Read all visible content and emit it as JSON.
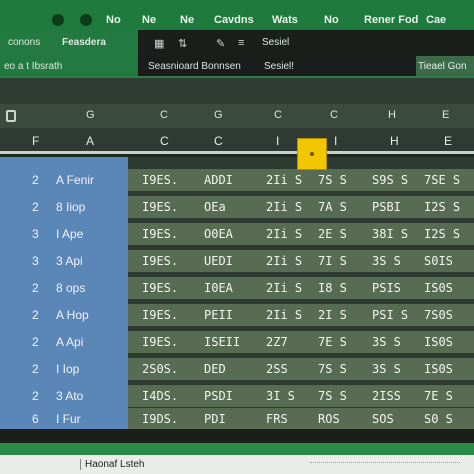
{
  "ribbon": {
    "tabs": [
      "No",
      "Ne",
      "Ne",
      "Cavdns",
      "Wats",
      "No",
      "Rener Fod",
      "Cae"
    ],
    "row2": {
      "left1": "conons",
      "left2": "Feasdera",
      "middle": "Sesiel",
      "middle2": "Seasnioard Bonnsen",
      "right": "Tieael Gon"
    },
    "namebar": {
      "left": "eo a t Ibsrath",
      "formula": "Sesiel!"
    }
  },
  "columns": [
    "G",
    "C",
    "G",
    "C",
    "C",
    "H",
    "E"
  ],
  "headers": [
    "F",
    "A",
    "C",
    "C",
    "I",
    "I",
    "H",
    "E"
  ],
  "rows": [
    {
      "num": "2",
      "label": "A Fenir",
      "cells": [
        "I9ES.",
        "ADDI",
        "2Ii S",
        "7S S",
        "S9S S",
        "7SE S"
      ]
    },
    {
      "num": "2",
      "label": "8 Iiop",
      "cells": [
        "I9ES.",
        "OEa",
        "2Ii S",
        "7A S",
        "PSBI",
        "I2S S"
      ]
    },
    {
      "num": "3",
      "label": "I Ape",
      "cells": [
        "I9ES.",
        "O0EA",
        "2Ii S",
        "2E S",
        "38I S",
        "I2S S"
      ]
    },
    {
      "num": "3",
      "label": "3 Api",
      "cells": [
        "I9ES.",
        "UEDI",
        "2Ii S",
        "7I S",
        "3S S",
        "S0IS"
      ]
    },
    {
      "num": "2",
      "label": "8 ops",
      "cells": [
        "I9ES.",
        "I0EA",
        "2Ii S",
        "I8 S",
        "PSIS",
        "IS0S"
      ]
    },
    {
      "num": "2",
      "label": "A Hop",
      "cells": [
        "I9ES.",
        "PEII",
        "2Ii S",
        "2I S",
        "PSI S",
        "7S0S"
      ]
    },
    {
      "num": "2",
      "label": "A Api",
      "cells": [
        "I9ES.",
        "ISEII",
        "2Z7",
        "7E S",
        "3S S",
        "IS0S"
      ]
    },
    {
      "num": "2",
      "label": "I Iop",
      "cells": [
        "2S0S.",
        "DED",
        "2SS",
        "7S S",
        "3S S",
        "IS0S"
      ]
    },
    {
      "num": "2",
      "label": "3 Ato",
      "cells": [
        "I4DS.",
        "PSDI",
        "3I S",
        "7S S",
        "2ISS",
        "7E S"
      ]
    },
    {
      "num": "6",
      "label": "I Fur",
      "cells": [
        "I9DS.",
        "PDI",
        "FRS",
        "ROS",
        "SOS",
        "S0 S"
      ]
    }
  ],
  "sheet_tab": "Haonaf Lsteh",
  "colors": {
    "ribbon": "#1f7a3d",
    "row_header": "#5b86b8",
    "cell_band": "#576c52",
    "selection": "#f2c600"
  }
}
